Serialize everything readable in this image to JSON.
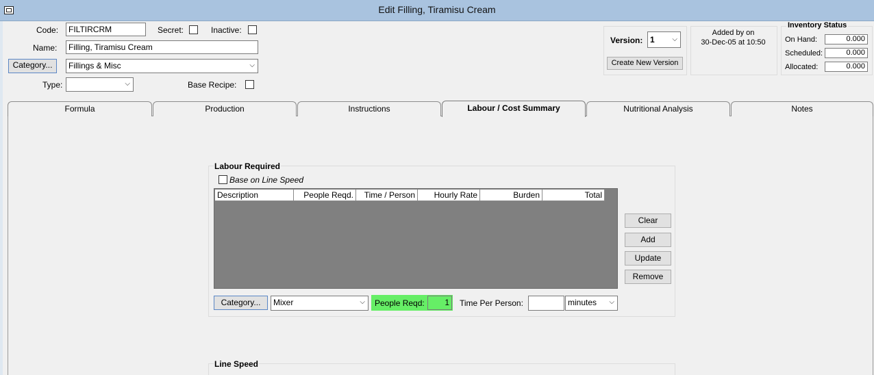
{
  "window": {
    "title": "Edit Filling, Tiramisu Cream",
    "icon": "app-icon"
  },
  "header": {
    "code_label": "Code:",
    "code_value": "FILTIRCRM",
    "secret_label": "Secret:",
    "secret_checked": false,
    "inactive_label": "Inactive:",
    "inactive_checked": false,
    "name_label": "Name:",
    "name_value": "Filling, Tiramisu Cream",
    "category_button": "Category...",
    "category_value": "Fillings & Misc",
    "type_label": "Type:",
    "type_value": "",
    "base_recipe_label": "Base Recipe:",
    "base_recipe_checked": false
  },
  "version": {
    "label": "Version:",
    "value": "1",
    "create_button": "Create New Version"
  },
  "added": {
    "line1": "Added by  on",
    "line2": "30-Dec-05 at 10:50"
  },
  "inventory": {
    "title": "Inventory Status",
    "on_hand_label": "On Hand:",
    "on_hand_value": "0.000",
    "scheduled_label": "Scheduled:",
    "scheduled_value": "0.000",
    "allocated_label": "Allocated:",
    "allocated_value": "0.000"
  },
  "tabs": [
    {
      "label": "Formula",
      "active": false
    },
    {
      "label": "Production",
      "active": false
    },
    {
      "label": "Instructions",
      "active": false
    },
    {
      "label": "Labour / Cost Summary",
      "active": true
    },
    {
      "label": "Nutritional Analysis",
      "active": false
    },
    {
      "label": "Notes",
      "active": false
    }
  ],
  "labour": {
    "title": "Labour Required",
    "base_on_line_speed_label": "Base on Line Speed",
    "base_on_line_speed_checked": false,
    "columns": [
      "Description",
      "People Reqd.",
      "Time / Person",
      "Hourly Rate",
      "Burden",
      "Total"
    ],
    "rows": [],
    "buttons": {
      "clear": "Clear",
      "add": "Add",
      "update": "Update",
      "remove": "Remove"
    },
    "category_button": "Category...",
    "category_value": "Mixer",
    "people_reqd_label": "People Reqd:",
    "people_reqd_value": "1",
    "time_per_person_label": "Time Per Person:",
    "time_per_person_value": "",
    "time_unit": "minutes"
  },
  "line_speed": {
    "title": "Line Speed"
  },
  "colors": {
    "titlebar": "#a9c3df",
    "highlight_green": "#66ee66",
    "grid_bg": "#808080"
  }
}
